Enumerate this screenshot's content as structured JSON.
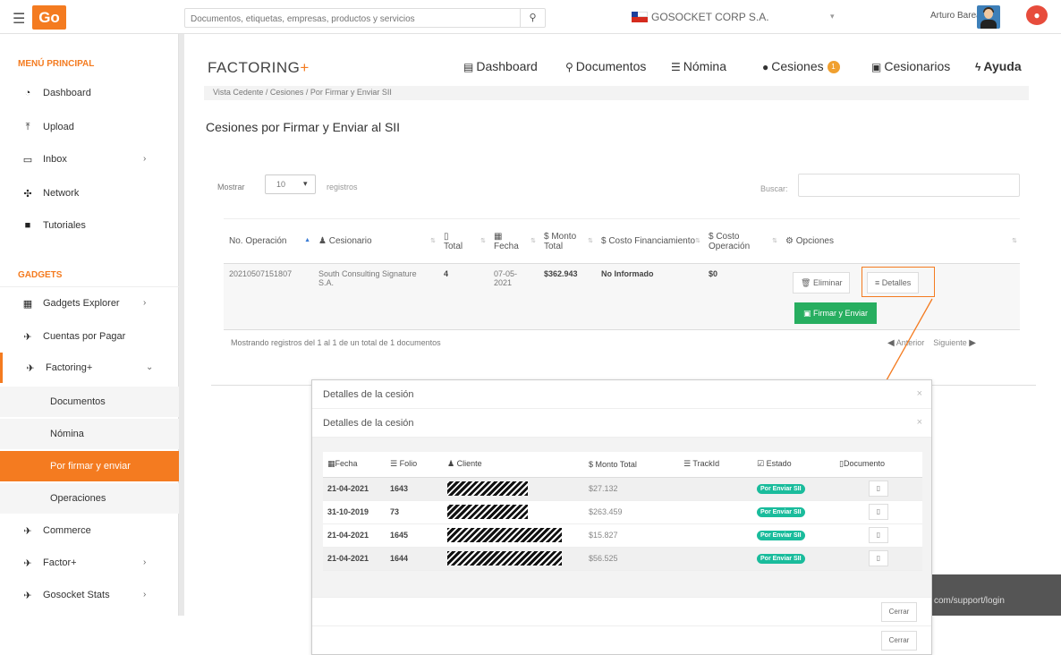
{
  "topbar": {
    "logo": "Go",
    "search_placeholder": "Documentos, etiquetas, empresas, productos y servicios",
    "company": "GOSOCKET CORP S.A.",
    "user": "Arturo Barea"
  },
  "sidebar": {
    "main_title": "MENÚ PRINCIPAL",
    "gadgets_title": "GADGETS",
    "items": [
      {
        "label": "Dashboard",
        "icon": "dashboard-icon",
        "glyph": "◔"
      },
      {
        "label": "Upload",
        "icon": "upload-icon",
        "glyph": "⤒"
      },
      {
        "label": "Inbox",
        "icon": "inbox-icon",
        "glyph": "▭"
      },
      {
        "label": "Network",
        "icon": "network-icon",
        "glyph": "✣"
      },
      {
        "label": "Tutoriales",
        "icon": "video-icon",
        "glyph": "■"
      }
    ],
    "gadgets": [
      {
        "label": "Gadgets Explorer",
        "icon": "grid-icon",
        "glyph": "▦"
      },
      {
        "label": "Cuentas por Pagar",
        "icon": "rocket-icon",
        "glyph": "✈"
      },
      {
        "label": "Factoring+",
        "icon": "rocket-icon",
        "glyph": "✈"
      },
      {
        "label": "Documentos"
      },
      {
        "label": "Nómina"
      },
      {
        "label": "Por firmar y enviar"
      },
      {
        "label": "Operaciones"
      },
      {
        "label": "Commerce",
        "icon": "rocket-icon",
        "glyph": "✈"
      },
      {
        "label": "Factor+",
        "icon": "rocket-icon",
        "glyph": "✈"
      },
      {
        "label": "Gosocket Stats",
        "icon": "rocket-icon",
        "glyph": "✈"
      }
    ]
  },
  "main": {
    "title": "FACTORING",
    "title_plus": "+",
    "nav": [
      {
        "label": "Dashboard",
        "glyph": "▤"
      },
      {
        "label": "Documentos",
        "glyph": "⚲"
      },
      {
        "label": "Nómina",
        "glyph": "☰"
      },
      {
        "label": "Cesiones",
        "glyph": "●",
        "badge": "1"
      },
      {
        "label": "Cesionarios",
        "glyph": "▣"
      },
      {
        "label": "Ayuda",
        "glyph": "ϟ"
      }
    ],
    "breadcrumb": "Vista Cedente / Cesiones / Por Firmar y Enviar SII",
    "subtitle": "Cesiones por Firmar y Enviar al SII",
    "length_label": "Mostrar",
    "length_value": "10",
    "length_suffix": "registros",
    "filter_label": "Buscar:",
    "table": {
      "headers": [
        "No. Operación",
        "Cesionario",
        "Total",
        "Fecha",
        "$ Monto Total",
        "$ Costo Financiamiento",
        "$ Costo Operación",
        "Opciones"
      ],
      "row": {
        "operacion": "20210507151807",
        "cesionario": "South Consulting Signature S.A.",
        "total": "4",
        "fecha": "07-05-2021",
        "monto": "$362.943",
        "costo_fin": "No Informado",
        "costo_op": "$0"
      },
      "btn_eliminar": "Eliminar",
      "btn_detalles": "Detalles",
      "btn_firmar": "Firmar y Enviar"
    },
    "info": "Mostrando registros del 1 al 1 de un total de 1 documentos",
    "prev": "Anterior",
    "next": "Siguiente"
  },
  "dark_box": {
    "text": "com/support/login"
  },
  "modal": {
    "title": "Detalles de la cesión",
    "headers": [
      "Fecha",
      "Folio",
      "Cliente",
      "$ Monto Total",
      "TrackId",
      "Estado",
      "Documento"
    ],
    "rows": [
      {
        "fecha": "21-04-2021",
        "folio": "1643",
        "monto": "$27.132",
        "estado": "Por Enviar SII"
      },
      {
        "fecha": "31-10-2019",
        "folio": "73",
        "monto": "$263.459",
        "estado": "Por Enviar SII"
      },
      {
        "fecha": "21-04-2021",
        "folio": "1645",
        "monto": "$15.827",
        "estado": "Por Enviar SII"
      },
      {
        "fecha": "21-04-2021",
        "folio": "1644",
        "monto": "$56.525",
        "estado": "Por Enviar SII"
      }
    ],
    "close": "Cerrar"
  }
}
